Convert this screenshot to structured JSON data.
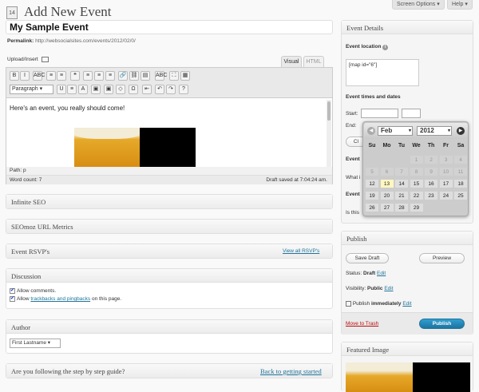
{
  "top": {
    "screen_options": "Screen Options ▾",
    "help": "Help ▾"
  },
  "header": {
    "icon_text": "14",
    "title": "Add New Event"
  },
  "post": {
    "title": "My Sample Event",
    "permalink_label": "Permalink:",
    "permalink_url": "http://websocialsites.com/events/2012/02/0/"
  },
  "editor": {
    "upload_label": "Upload/Insert",
    "tabs": [
      "Visual",
      "HTML"
    ],
    "row1": [
      "B",
      "I",
      "ABC",
      "≡",
      "≡",
      "❝",
      "≡",
      "≡",
      "≡",
      "🔗",
      "⛓",
      "▤",
      "ABC",
      "⛶",
      "▦"
    ],
    "format_select": "Paragraph",
    "row2": [
      "U",
      "≡",
      "A",
      "▣",
      "▣",
      "◇",
      "Ω",
      "⇤",
      "↶",
      "↷",
      "?"
    ],
    "content": "Here's an event, you really should come!",
    "path": "Path: p",
    "word_count": "Word count: 7",
    "draft_saved": "Draft saved at 7:04:24 am."
  },
  "boxes": {
    "infinite_seo": "Infinite SEO",
    "seomoz": "SEOmoz URL Metrics",
    "rsvp": "Event RSVP's",
    "rsvp_link": "View all RSVP's",
    "discussion": "Discussion",
    "allow_comments": "Allow comments.",
    "allow_prefix": "Allow",
    "trackbacks": "trackbacks and pingbacks",
    "allow_suffix": "on this page.",
    "author": "Author",
    "author_value": "First Lastname",
    "guide": "Are you following the step by step guide?",
    "guide_link": "Back to getting started"
  },
  "event_details": {
    "title": "Event Details",
    "location_label": "Event location",
    "location_value": "[map id=\"6\"]",
    "times_label": "Event times and dates",
    "start": "Start:",
    "end": "End:",
    "cl": "Cl",
    "event1": "Event",
    "whati": "What i",
    "event2": "Event",
    "isthis": "Is this"
  },
  "calendar": {
    "month": "Feb",
    "year": "2012",
    "dow": [
      "Su",
      "Mo",
      "Tu",
      "We",
      "Th",
      "Fr",
      "Sa"
    ],
    "rows": [
      [
        "",
        "",
        "",
        "1",
        "2",
        "3",
        "4"
      ],
      [
        "5",
        "6",
        "7",
        "8",
        "9",
        "10",
        "11"
      ],
      [
        "12",
        "13",
        "14",
        "15",
        "16",
        "17",
        "18"
      ],
      [
        "19",
        "20",
        "21",
        "22",
        "23",
        "24",
        "25"
      ],
      [
        "26",
        "27",
        "28",
        "29",
        "",
        "",
        ""
      ]
    ],
    "today": "13"
  },
  "publish": {
    "title": "Publish",
    "save_draft": "Save Draft",
    "preview": "Preview",
    "status_label": "Status:",
    "status_value": "Draft",
    "edit": "Edit",
    "visibility_label": "Visibility:",
    "visibility_value": "Public",
    "publish_label": "Publish",
    "publish_value": "immediately",
    "trash": "Move to Trash",
    "publish_button": "Publish"
  },
  "featured": {
    "title": "Featured Image"
  },
  "colors": {
    "link": "#21759b",
    "trash": "#bc0b0b",
    "primary": "#21759b"
  }
}
